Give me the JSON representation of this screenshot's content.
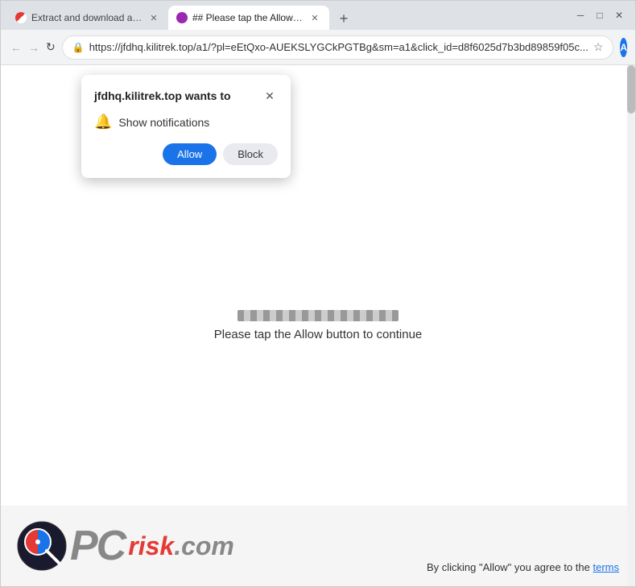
{
  "browser": {
    "tabs": [
      {
        "id": "tab1",
        "title": "Extract and download audio an...",
        "favicon_type": "video",
        "active": false
      },
      {
        "id": "tab2",
        "title": "## Please tap the Allow button...",
        "favicon_type": "default",
        "active": true
      }
    ],
    "new_tab_label": "+",
    "window_controls": {
      "minimize": "─",
      "maximize": "□",
      "close": "✕"
    },
    "nav": {
      "back": "←",
      "forward": "→",
      "refresh": "↻"
    },
    "url": "https://jfdhq.kilitrek.top/a1/?pl=eEtQxo-AUEKSLYGCkPGTBg&sm=a1&click_id=d8f6025d7b3bd89859f05c...",
    "star_icon": "☆",
    "profile_letter": "A",
    "menu_icon": "⋮"
  },
  "popup": {
    "title": "jfdhq.kilitrek.top wants to",
    "close_icon": "✕",
    "bell_icon": "🔔",
    "body_text": "Show notifications",
    "allow_label": "Allow",
    "block_label": "Block"
  },
  "page": {
    "instruction": "Please tap the Allow button to continue"
  },
  "footer": {
    "logo_pc": "PC",
    "logo_risk": "risk",
    "logo_com": ".com",
    "terms_text": "By clicking \"Allow\" you agree to the",
    "terms_link": "terms"
  }
}
